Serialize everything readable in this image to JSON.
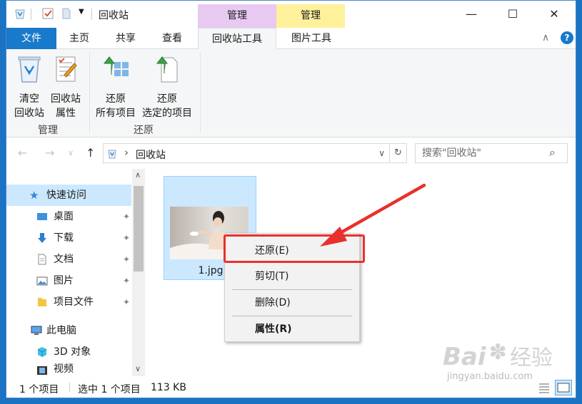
{
  "window": {
    "title": "回收站",
    "contextual_tabs": [
      "管理",
      "管理"
    ],
    "minimize": "—",
    "maximize": "☐",
    "close": "✕"
  },
  "ribbon_tabs": [
    {
      "label": "文件"
    },
    {
      "label": "主页"
    },
    {
      "label": "共享"
    },
    {
      "label": "查看"
    },
    {
      "label": "回收站工具"
    },
    {
      "label": "图片工具"
    }
  ],
  "ribbon": {
    "groups": [
      {
        "label": "管理",
        "buttons": [
          {
            "line1": "清空",
            "line2": "回收站"
          },
          {
            "line1": "回收站",
            "line2": "属性"
          }
        ]
      },
      {
        "label": "还原",
        "buttons": [
          {
            "line1": "还原",
            "line2": "所有项目"
          },
          {
            "line1": "还原",
            "line2": "选定的项目"
          }
        ]
      }
    ],
    "collapse": "∧",
    "help": "?"
  },
  "address": {
    "path": "回收站",
    "separator": "›",
    "back": "←",
    "forward": "→",
    "recent": "∨",
    "up": "↑",
    "dropdown": "∨",
    "refresh": "↻"
  },
  "search": {
    "placeholder": "搜索\"回收站\"",
    "icon": "⌕"
  },
  "nav_pane": {
    "quick_access": "快速访问",
    "items": [
      {
        "label": "桌面"
      },
      {
        "label": "下载"
      },
      {
        "label": "文档"
      },
      {
        "label": "图片"
      },
      {
        "label": "项目文件"
      }
    ],
    "pin": "✦",
    "this_pc": "此电脑",
    "pc_items": [
      {
        "label": "3D 对象"
      },
      {
        "label": "视频"
      }
    ],
    "scroll_up": "∧",
    "scroll_down": "∨"
  },
  "file": {
    "name": "1.jpg"
  },
  "context_menu": {
    "items": [
      "还原(E)",
      "剪切(T)",
      "删除(D)",
      "属性(R)"
    ]
  },
  "status": {
    "count": "1 个项目",
    "selected": "选中 1 个项目",
    "size": "113 KB"
  },
  "colors": {
    "accent": "#1979ca",
    "selection": "#cce8ff",
    "annotation": "#e8312c",
    "contextual_tab_a": "#e8c9f2",
    "contextual_tab_b": "#fff19c"
  },
  "watermark": {
    "brand": "Bai",
    "brand2": "经验",
    "url": "jingyan.baidu.com"
  }
}
